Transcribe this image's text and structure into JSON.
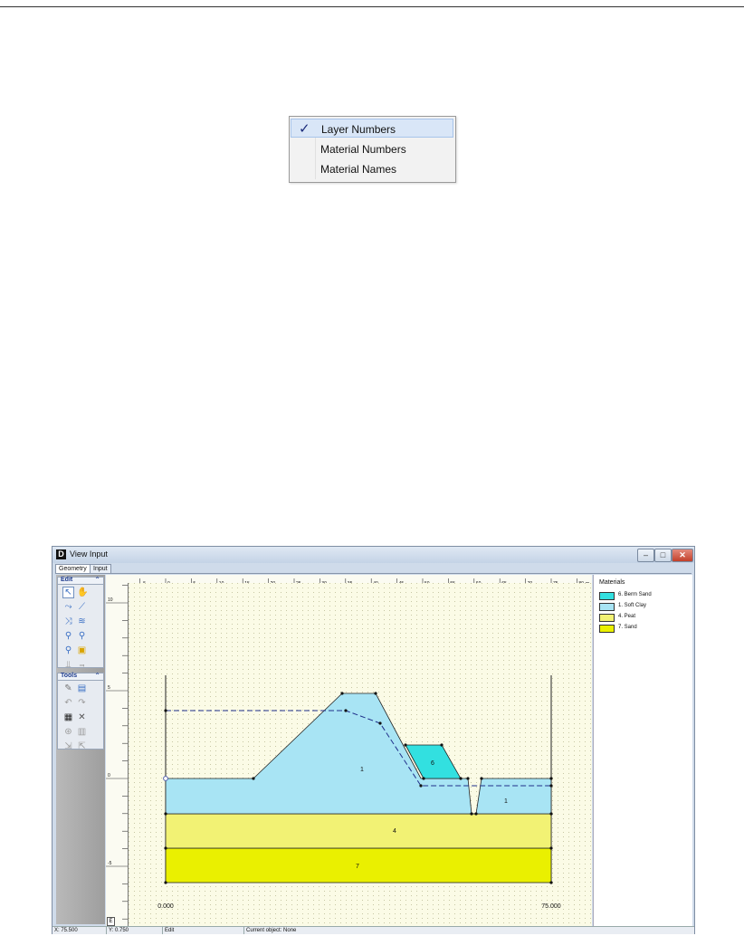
{
  "context_menu": {
    "items": [
      {
        "label": "Layer Numbers",
        "checked": true
      },
      {
        "label": "Material Numbers",
        "checked": false
      },
      {
        "label": "Material Names",
        "checked": false
      }
    ],
    "check_glyph": "✓"
  },
  "window": {
    "app_icon": "D",
    "title": "View Input",
    "buttons": {
      "minimize": "–",
      "maximize": "□",
      "close": "✕"
    },
    "tabs": [
      {
        "label": "Geometry",
        "active": true
      },
      {
        "label": "Input",
        "active": false
      }
    ]
  },
  "tool_panel": {
    "edit_group": {
      "title": "Edit",
      "collapse_glyph": "⌃"
    },
    "tools_group": {
      "title": "Tools",
      "collapse_glyph": "⌃"
    }
  },
  "ruler": {
    "x_ticks": [
      "-5",
      "0",
      "5",
      "10",
      "15",
      "20",
      "25",
      "30",
      "35",
      "40",
      "45",
      "50",
      "55",
      "60",
      "65",
      "70",
      "75",
      "80"
    ],
    "x_unit": "m",
    "y_ticks": [
      "10",
      "5",
      "0",
      "-5"
    ],
    "corner": "E"
  },
  "drawing": {
    "left_label": "0.000",
    "right_label": "75.000",
    "layer_labels": [
      "1",
      "6",
      "1",
      "4",
      "7"
    ],
    "colors": {
      "soft_clay": "#a8e4f4",
      "berm_sand": "#32e0e0",
      "peat": "#f2f274",
      "sand": "#eaf000"
    }
  },
  "legend": {
    "title": "Materials",
    "items": [
      {
        "label": "6. Berm Sand",
        "color": "#32e0e0"
      },
      {
        "label": "1. Soft Clay",
        "color": "#a8e4f4"
      },
      {
        "label": "4. Peat",
        "color": "#f2f274"
      },
      {
        "label": "7. Sand",
        "color": "#eaf000"
      }
    ]
  },
  "status": {
    "x": "X: 75.500",
    "y": "Y: 0.750",
    "mode": "Edit",
    "current_object": "Current object: None"
  }
}
